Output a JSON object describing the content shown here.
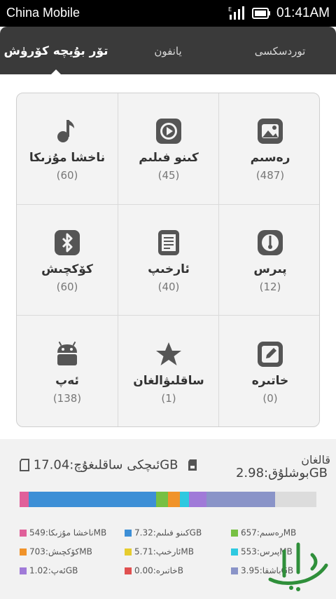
{
  "status": {
    "carrier": "China Mobile",
    "time": "01:41AM"
  },
  "tabs": [
    {
      "label": "تۆر بۇيچە كۆرۈش",
      "active": true
    },
    {
      "label": "يانفون"
    },
    {
      "label": "توردسكسى"
    }
  ],
  "categories": [
    {
      "label": "ناخشا مۇزىكا",
      "count": "(60)",
      "icon": "music-note-icon"
    },
    {
      "label": "كىنو فىلىم",
      "count": "(45)",
      "icon": "play-icon"
    },
    {
      "label": "رەسىم",
      "count": "(487)",
      "icon": "image-icon"
    },
    {
      "label": "كۆكچىش",
      "count": "(60)",
      "icon": "bluetooth-icon"
    },
    {
      "label": "ئارخىپ",
      "count": "(40)",
      "icon": "document-icon"
    },
    {
      "label": "پىرس",
      "count": "(12)",
      "icon": "gauge-icon"
    },
    {
      "label": "ئەپ",
      "count": "(138)",
      "icon": "android-icon"
    },
    {
      "label": "ساقلىۋالغان",
      "count": "(1)",
      "icon": "star-icon"
    },
    {
      "label": "خاتىرە",
      "count": "(0)",
      "icon": "edit-icon"
    }
  ],
  "storage": {
    "sd_label": "ئىچكى ساقلىغۇچ:17.04GB",
    "free_label": "قالغان",
    "free_value": "بوشلۇق:2.98GB",
    "segments": [
      {
        "color": "#e0609a",
        "fraction": 0.03
      },
      {
        "color": "#3d8fd6",
        "fraction": 0.43
      },
      {
        "color": "#77c043",
        "fraction": 0.04
      },
      {
        "color": "#f0932a",
        "fraction": 0.04
      },
      {
        "color": "#2ec9e0",
        "fraction": 0.03
      },
      {
        "color": "#a07ad8",
        "fraction": 0.06
      },
      {
        "color": "#8a94c8",
        "fraction": 0.23
      }
    ],
    "legend": [
      {
        "text": "ناخشا مۇزىكا:549MB",
        "color": "#e0609a"
      },
      {
        "text": "كىنو فىلىم:7.32GB",
        "color": "#3d8fd6"
      },
      {
        "text": "رەسىم:657MB",
        "color": "#77c043"
      },
      {
        "text": "كۆكچىش:703MB",
        "color": "#f0932a"
      },
      {
        "text": "ئارخىپ:5.71MB",
        "color": "#e6cc2e"
      },
      {
        "text": "پىرس:553MB",
        "color": "#2ec9e0"
      },
      {
        "text": "ئەپ:1.02GB",
        "color": "#a07ad8"
      },
      {
        "text": "خاتىرە:0.00B",
        "color": "#e05050"
      },
      {
        "text": "باشقا:3.95GB",
        "color": "#8a94c8"
      }
    ]
  }
}
